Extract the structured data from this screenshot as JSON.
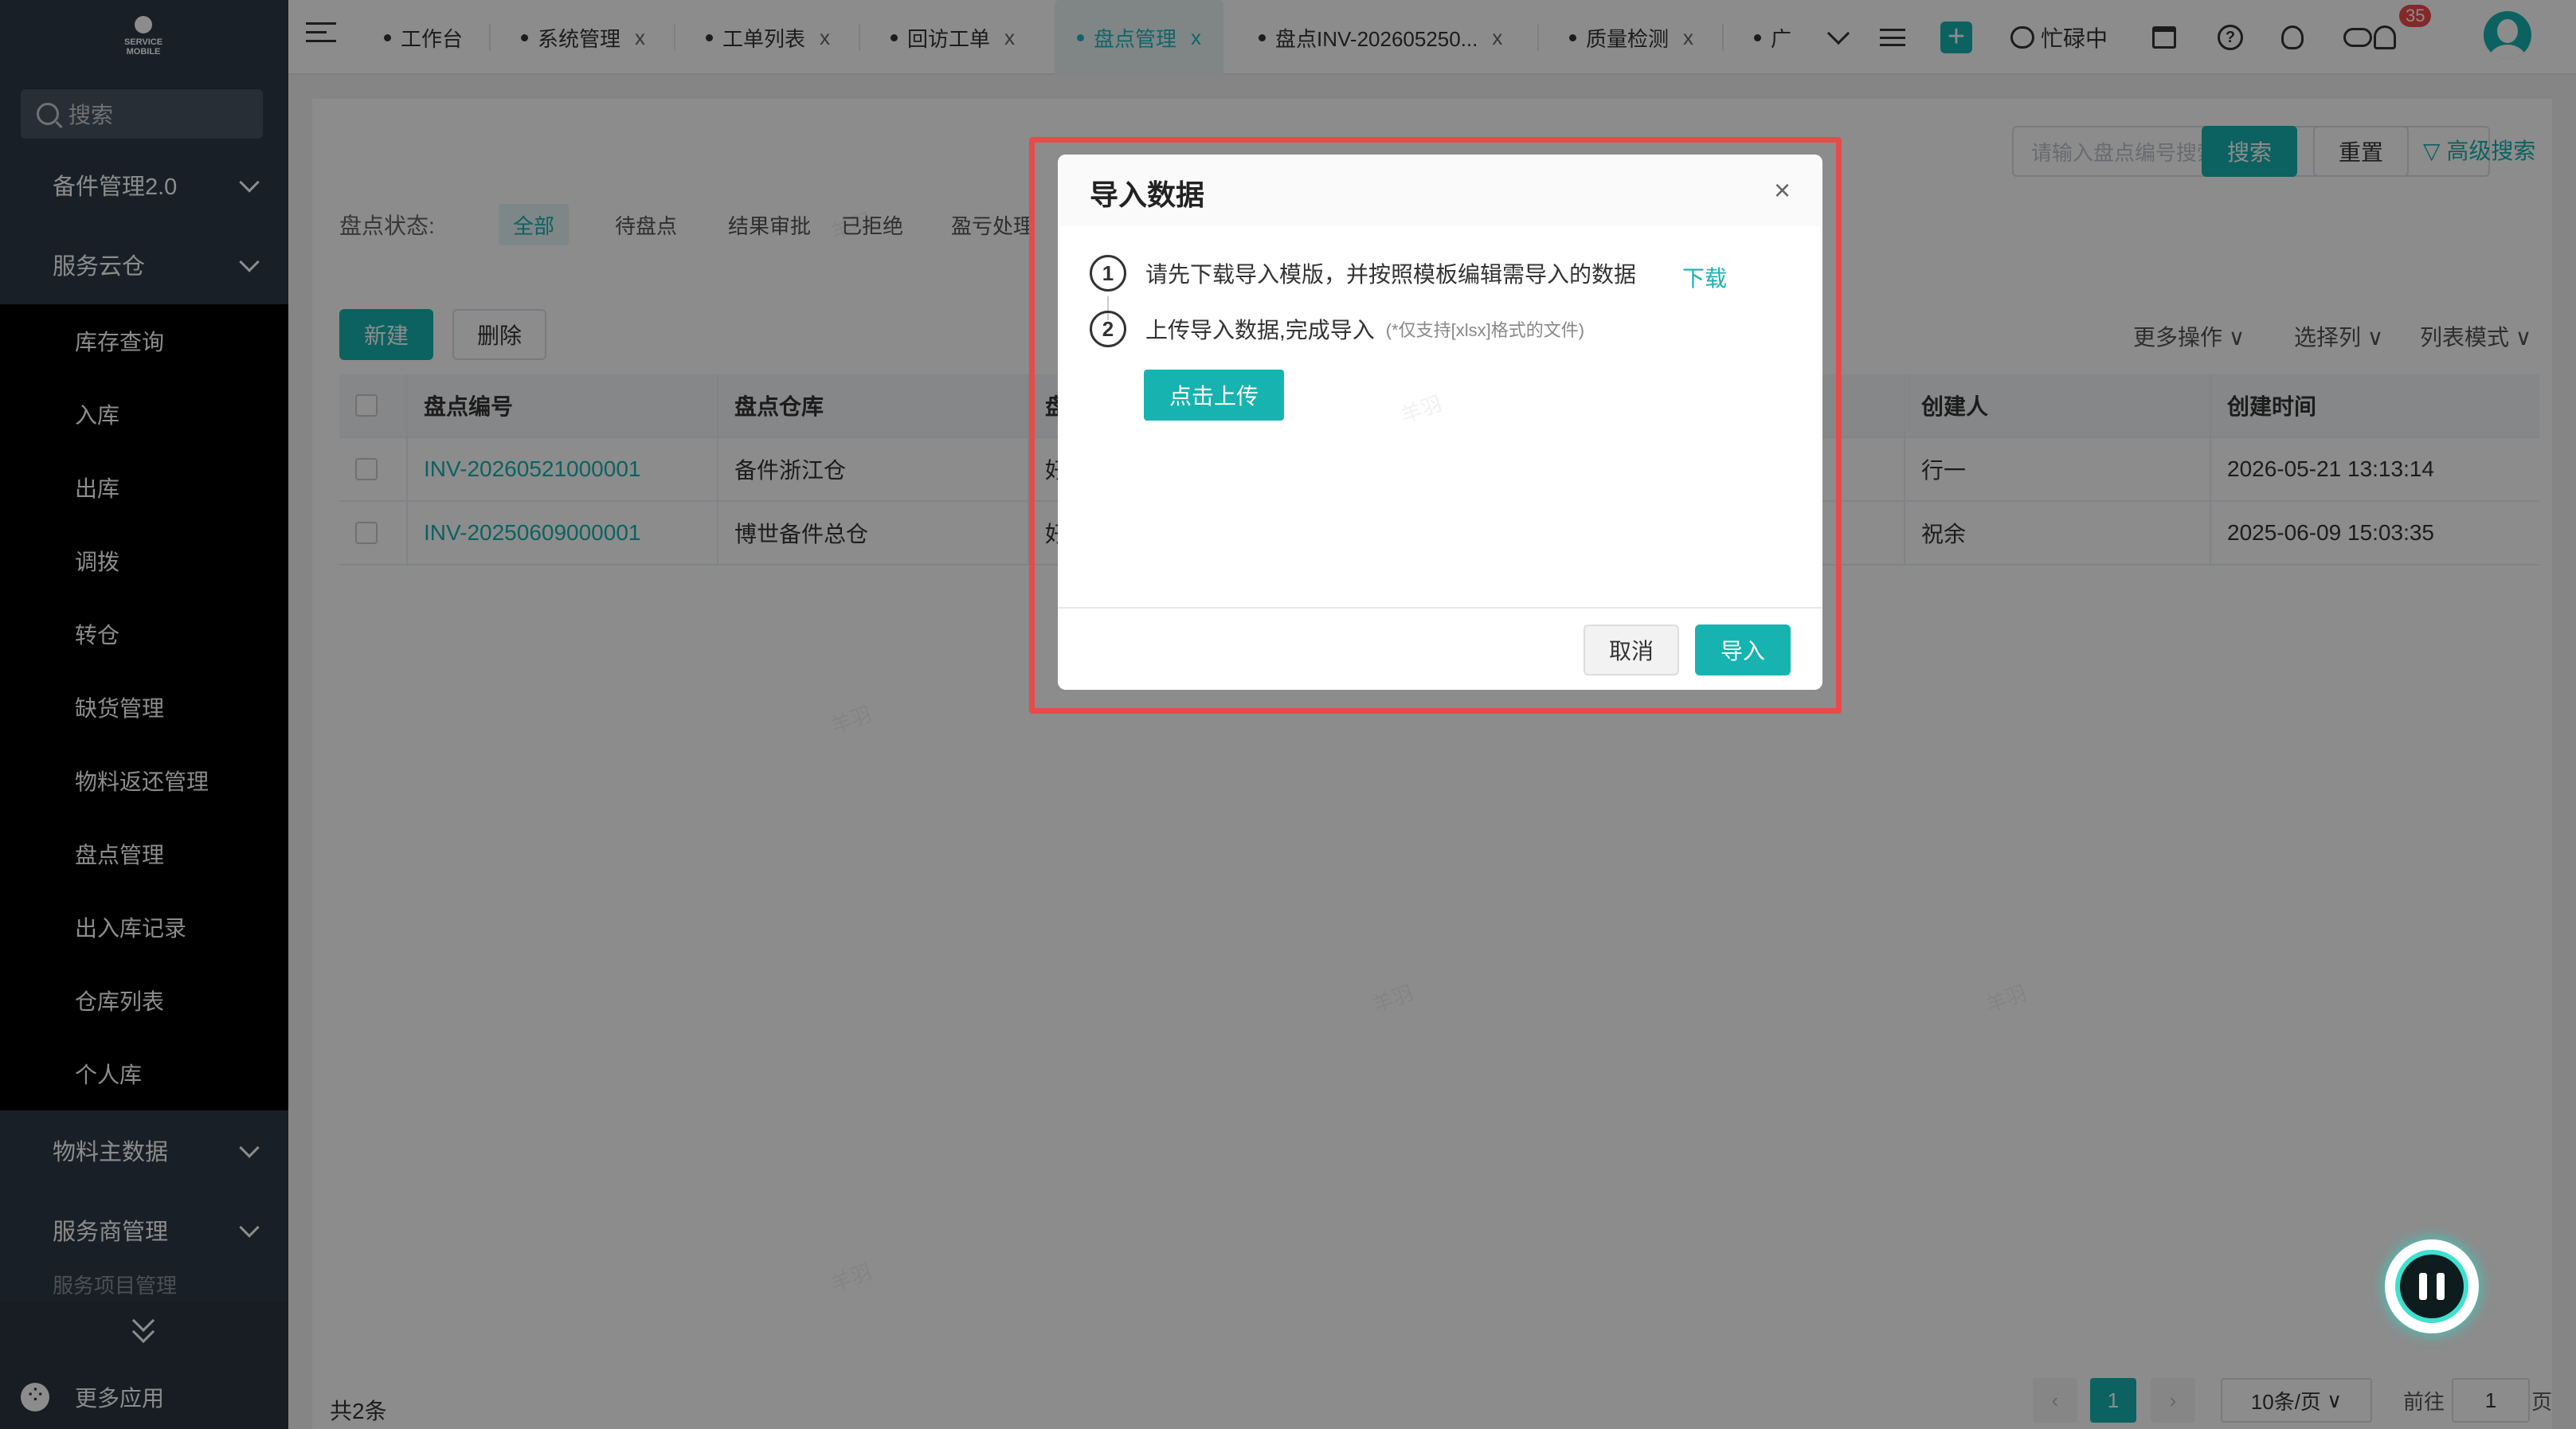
{
  "sidebar": {
    "logo_text": "SERVICE MOBILE",
    "search_placeholder": "搜索",
    "groups_top": [
      {
        "label": "备件管理2.0"
      },
      {
        "label": "服务云仓"
      }
    ],
    "sub_items": [
      "库存查询",
      "入库",
      "出库",
      "调拨",
      "转仓",
      "缺货管理",
      "物料返还管理",
      "盘点管理",
      "出入库记录",
      "仓库列表",
      "个人库"
    ],
    "groups_bottom": [
      {
        "label": "物料主数据"
      },
      {
        "label": "服务商管理"
      }
    ],
    "cut_off_item": "服务项目管理",
    "more_apps": "更多应用"
  },
  "topbar": {
    "tabs": [
      {
        "label": "工作台",
        "closable": false
      },
      {
        "label": "系统管理",
        "closable": true
      },
      {
        "label": "工单列表",
        "closable": true
      },
      {
        "label": "回访工单",
        "closable": true
      },
      {
        "label": "盘点管理",
        "closable": true,
        "active": true
      },
      {
        "label": "盘点INV-202605250...",
        "closable": true
      },
      {
        "label": "质量检测",
        "closable": true
      },
      {
        "label": "广",
        "closable": false
      }
    ],
    "close_glyph": "x",
    "status": "忙碌中",
    "notification_count": "35"
  },
  "main": {
    "search_placeholder": "请输入盘点编号搜索",
    "search_button": "搜索",
    "reset_button": "重置",
    "advanced_search": "高级搜索",
    "status_label": "盘点状态:",
    "status_tabs": [
      "全部",
      "待盘点",
      "结果审批",
      "已拒绝",
      "盈亏处理"
    ],
    "new_button": "新建",
    "delete_button": "删除",
    "more_actions": "更多操作",
    "select_columns": "选择列",
    "list_mode": "列表模式",
    "table": {
      "columns": [
        "盘点编号",
        "盘点仓库",
        "盘",
        "创建人",
        "创建时间"
      ],
      "rows": [
        {
          "code": "INV-20260521000001",
          "warehouse": "备件浙江仓",
          "status": "好",
          "creator": "行一",
          "created": "2026-05-21 13:13:14"
        },
        {
          "code": "INV-20250609000001",
          "warehouse": "博世备件总仓",
          "status": "好",
          "creator": "祝余",
          "created": "2025-06-09 15:03:35"
        }
      ]
    },
    "total": "共2条",
    "pager": {
      "current": "1",
      "page_size": "10条/页",
      "goto_label": "前往",
      "goto_value": "1",
      "page_suffix": "页"
    },
    "watermark": "羊羽"
  },
  "modal": {
    "title": "导入数据",
    "close": "×",
    "step1_num": "1",
    "step1_text": "请先下载导入模版，并按照模板编辑需导入的数据",
    "download": "下载",
    "step2_num": "2",
    "step2_text": "上传导入数据,完成导入",
    "step2_note": "(*仅支持[xlsx]格式的文件)",
    "upload_button": "点击上传",
    "cancel_button": "取消",
    "import_button": "导入"
  },
  "colors": {
    "accent": "#17b3b0",
    "highlight": "#e84a4a",
    "sidebar": "#2f3a45"
  }
}
